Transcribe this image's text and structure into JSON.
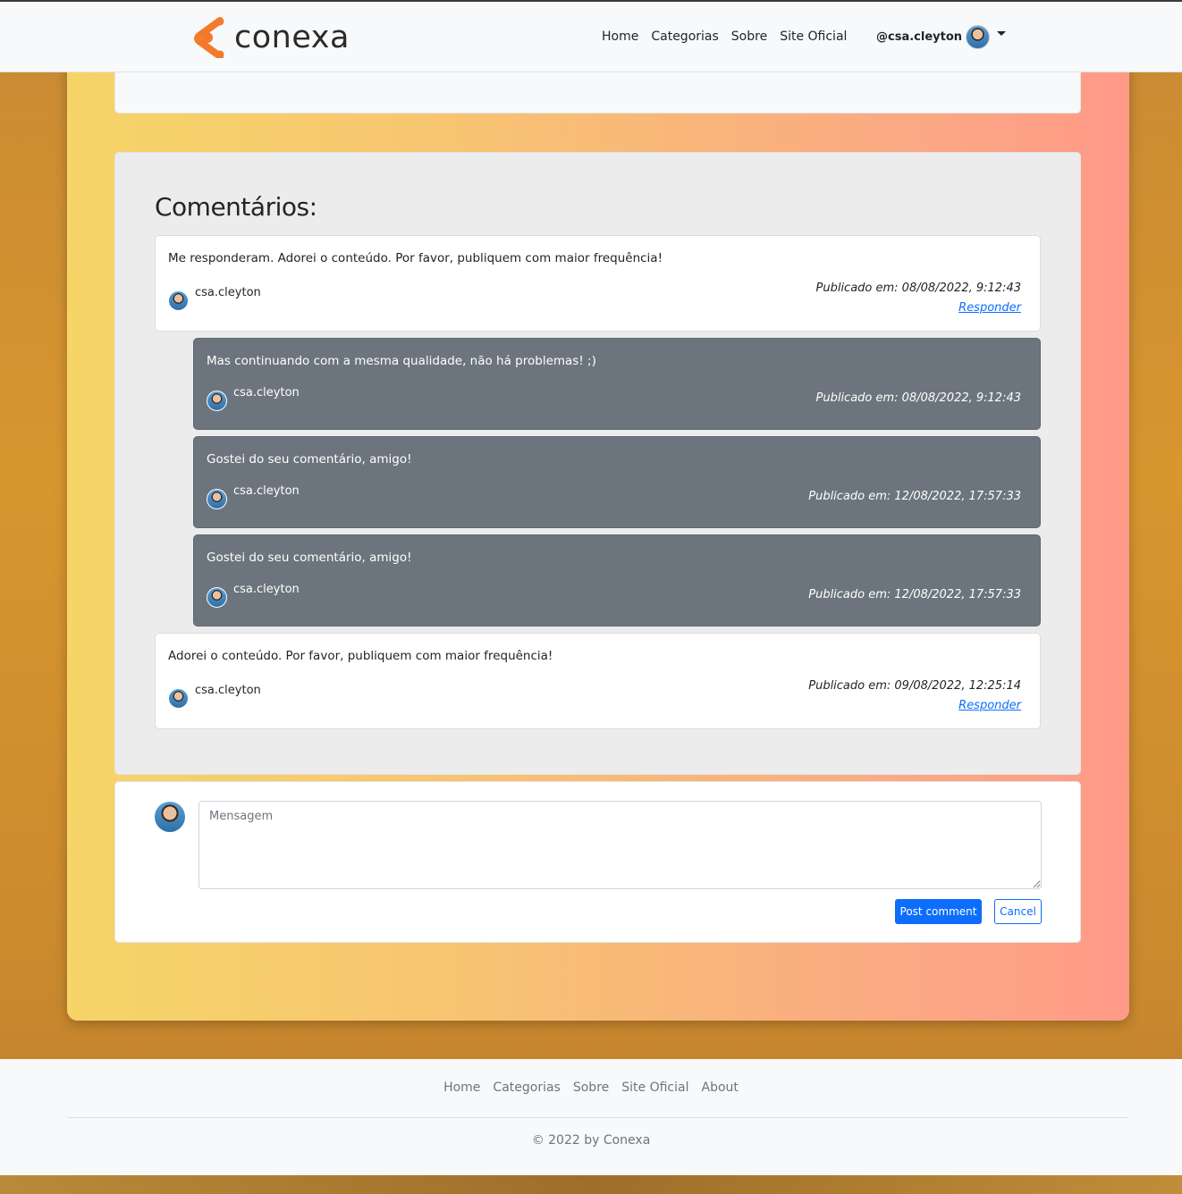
{
  "brand": {
    "name": "conexa",
    "accent_color": "#f37a2b"
  },
  "navbar": {
    "links": [
      "Home",
      "Categorias",
      "Sobre",
      "Site Oficial"
    ],
    "user_handle": "@csa.cleyton",
    "avatar_icon": "user-avatar-icon",
    "dropdown_icon": "caret-down-icon"
  },
  "comments_section": {
    "title": "Comentários:",
    "comments": [
      {
        "text": "Me responderam. Adorei o conteúdo. Por favor, publiquem com maior frequência!",
        "author": "csa.cleyton",
        "date": "Publicado em: 08/08/2022, 9:12:43",
        "reply_label": "Responder",
        "style": "light"
      },
      {
        "text": "Mas continuando com a mesma qualidade, não há problemas! ;)",
        "author": "csa.cleyton",
        "date": "Publicado em: 08/08/2022, 9:12:43",
        "style": "dark"
      },
      {
        "text": "Gostei do seu comentário, amigo!",
        "author": "csa.cleyton",
        "date": "Publicado em: 12/08/2022, 17:57:33",
        "style": "dark"
      },
      {
        "text": "Gostei do seu comentário, amigo!",
        "author": "csa.cleyton",
        "date": "Publicado em: 12/08/2022, 17:57:33",
        "style": "dark"
      },
      {
        "text": "Adorei o conteúdo. Por favor, publiquem com maior frequência!",
        "author": "csa.cleyton",
        "date": "Publicado em: 09/08/2022, 12:25:14",
        "reply_label": "Responder",
        "style": "light"
      }
    ]
  },
  "post_form": {
    "placeholder": "Mensagem",
    "value": "",
    "post_label": "Post comment",
    "cancel_label": "Cancel"
  },
  "footer": {
    "links": [
      "Home",
      "Categorias",
      "Sobre",
      "Site Oficial",
      "About"
    ],
    "copyright": "© 2022 by Conexa"
  },
  "colors": {
    "primary": "#0d6efd",
    "reply_bg": "#6c757d",
    "gradient_start": "#f6d468",
    "gradient_end": "#ff9a88"
  }
}
